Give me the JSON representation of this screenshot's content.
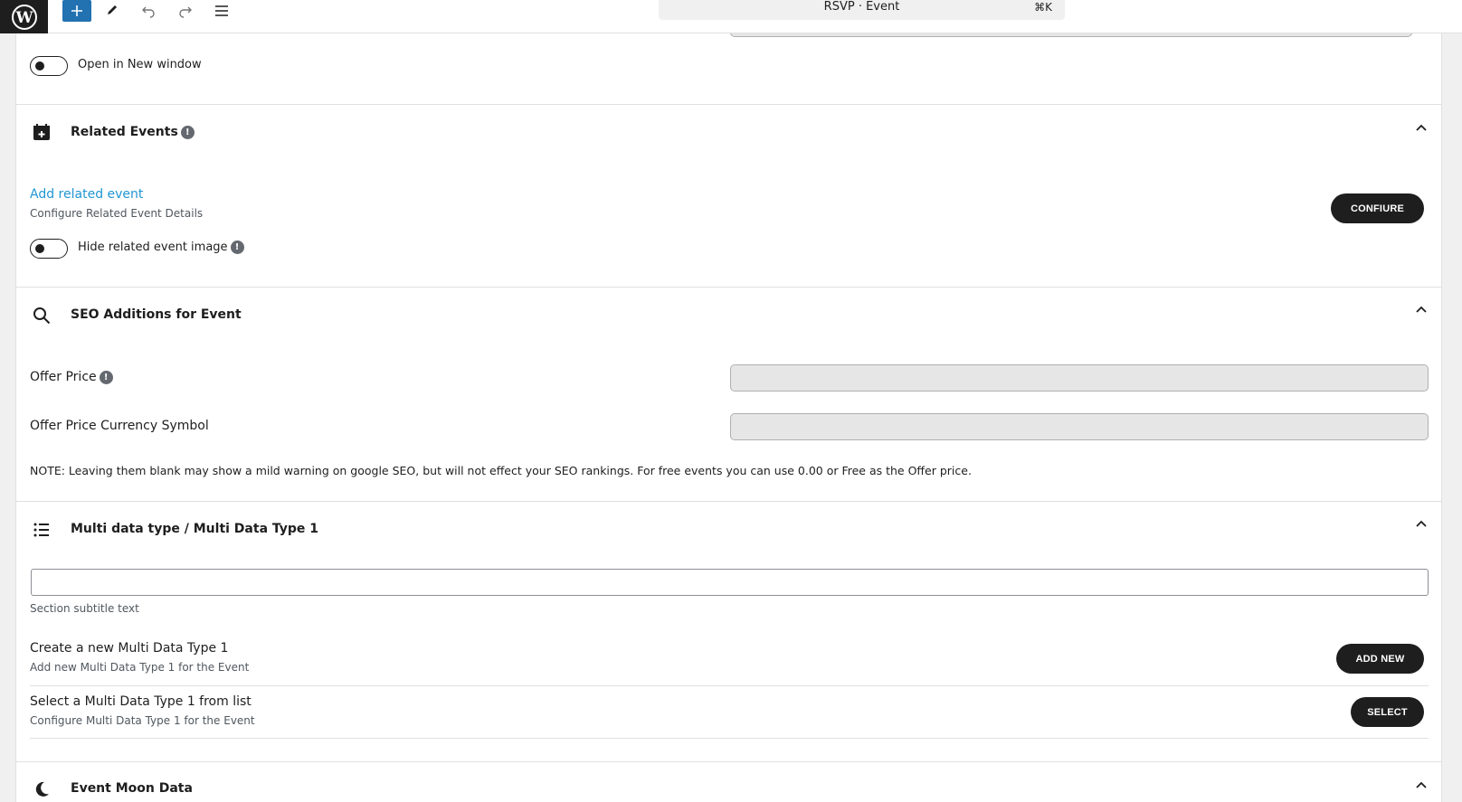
{
  "toolbar": {
    "command_title": "RSVP · Event",
    "command_shortcut": "⌘K",
    "icons": [
      "wordpress-logo",
      "plus-icon",
      "pencil-icon",
      "undo-icon",
      "redo-icon",
      "list-view-icon"
    ]
  },
  "link_section": {
    "open_new_window_label": "Open in New window"
  },
  "related_events": {
    "title": "Related Events",
    "add_link": "Add related event",
    "add_desc": "Configure Related Event Details",
    "configure_button": "CONFIURE",
    "hide_image_label": "Hide related event image"
  },
  "seo": {
    "title": "SEO Additions for Event",
    "offer_price_label": "Offer Price",
    "offer_price_value": "",
    "currency_label": "Offer Price Currency Symbol",
    "currency_value": "",
    "note": "NOTE: Leaving them blank may show a mild warning on google SEO, but will not effect your SEO rankings. For free events you can use 0.00 or Free as the Offer price."
  },
  "multi_data": {
    "title": "Multi data type / Multi Data Type 1",
    "subtitle_value": "",
    "subtitle_help": "Section subtitle text",
    "create_title": "Create a new Multi Data Type 1",
    "create_desc": "Add new Multi Data Type 1 for the Event",
    "add_new_button": "ADD NEW",
    "select_title": "Select a Multi Data Type 1 from list",
    "select_desc": "Configure Multi Data Type 1 for the Event",
    "select_button": "SELECT"
  },
  "moon": {
    "title": "Event Moon Data"
  },
  "colors": {
    "accent": "#2271b1",
    "link": "#2196d3",
    "dark": "#1e1e1e"
  }
}
